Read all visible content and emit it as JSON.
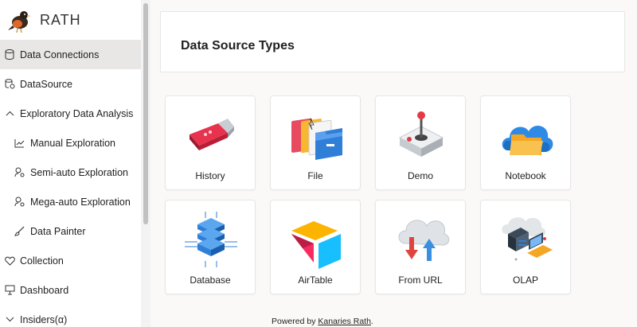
{
  "app": {
    "name": "RATH"
  },
  "sidebar": {
    "items": [
      {
        "label": "Data Connections",
        "icon": "database-icon",
        "active": true
      },
      {
        "label": "DataSource",
        "icon": "datasource-icon"
      },
      {
        "label": "Exploratory Data Analysis",
        "icon": "chevron-up-icon"
      },
      {
        "label": "Manual Exploration",
        "icon": "line-chart-icon"
      },
      {
        "label": "Semi-auto Exploration",
        "icon": "user-gear-icon"
      },
      {
        "label": "Mega-auto Exploration",
        "icon": "user-gear-icon"
      },
      {
        "label": "Data Painter",
        "icon": "brush-icon"
      },
      {
        "label": "Collection",
        "icon": "heart-icon"
      },
      {
        "label": "Dashboard",
        "icon": "presentation-icon"
      },
      {
        "label": "Insiders(α)",
        "icon": "chevron-down-icon"
      }
    ]
  },
  "main": {
    "title": "Data Source Types",
    "tiles": [
      {
        "label": "History",
        "icon": "usb-drive-icon"
      },
      {
        "label": "File",
        "icon": "folders-icon"
      },
      {
        "label": "Demo",
        "icon": "joystick-icon"
      },
      {
        "label": "Notebook",
        "icon": "cloud-folder-icon"
      },
      {
        "label": "Database",
        "icon": "database-chip-icon"
      },
      {
        "label": "AirTable",
        "icon": "airtable-icon"
      },
      {
        "label": "From URL",
        "icon": "cloud-transfer-icon"
      },
      {
        "label": "OLAP",
        "icon": "server-laptop-icon"
      }
    ]
  },
  "footer": {
    "prefix": "Powered by ",
    "link": "Kanaries Rath",
    "suffix": "."
  },
  "colors": {
    "active_bg": "#e8e7e6",
    "main_bg": "#faf9f8",
    "accent_blue": "#2f7fd8"
  }
}
